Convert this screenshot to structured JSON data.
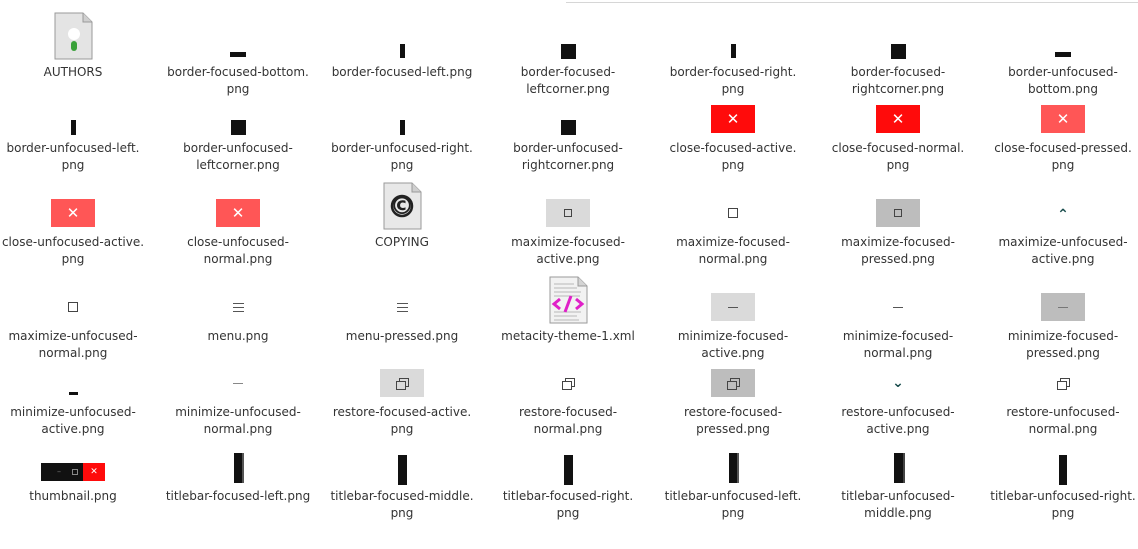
{
  "files": [
    {
      "name": "AUTHORS",
      "icon": "person-document-icon"
    },
    {
      "name": "border-focused-bottom.\npng",
      "icon": "black-bar-image-icon"
    },
    {
      "name": "border-focused-left.png",
      "icon": "black-bar-image-icon"
    },
    {
      "name": "border-focused-\nleftcorner.png",
      "icon": "black-square-image-icon"
    },
    {
      "name": "border-focused-right.\npng",
      "icon": "black-bar-image-icon"
    },
    {
      "name": "border-focused-\nrightcorner.png",
      "icon": "black-square-image-icon"
    },
    {
      "name": "border-unfocused-\nbottom.png",
      "icon": "black-bar-image-icon"
    },
    {
      "name": "border-unfocused-left.\npng",
      "icon": "black-bar-image-icon"
    },
    {
      "name": "border-unfocused-\nleftcorner.png",
      "icon": "black-square-image-icon"
    },
    {
      "name": "border-unfocused-right.\npng",
      "icon": "black-bar-image-icon"
    },
    {
      "name": "border-unfocused-\nrightcorner.png",
      "icon": "black-square-image-icon"
    },
    {
      "name": "close-focused-active.\npng",
      "icon": "close-icon"
    },
    {
      "name": "close-focused-normal.\npng",
      "icon": "close-icon"
    },
    {
      "name": "close-focused-pressed.\npng",
      "icon": "close-icon"
    },
    {
      "name": "close-unfocused-active.\npng",
      "icon": "close-icon"
    },
    {
      "name": "close-unfocused-\nnormal.png",
      "icon": "close-icon"
    },
    {
      "name": "COPYING",
      "icon": "copyright-document-icon"
    },
    {
      "name": "maximize-focused-\nactive.png",
      "icon": "maximize-icon"
    },
    {
      "name": "maximize-focused-\nnormal.png",
      "icon": "maximize-icon"
    },
    {
      "name": "maximize-focused-\npressed.png",
      "icon": "maximize-icon"
    },
    {
      "name": "maximize-unfocused-\nactive.png",
      "icon": "chevron-up-icon"
    },
    {
      "name": "maximize-unfocused-\nnormal.png",
      "icon": "maximize-icon"
    },
    {
      "name": "menu.png",
      "icon": "menu-icon"
    },
    {
      "name": "menu-pressed.png",
      "icon": "menu-icon"
    },
    {
      "name": "metacity-theme-1.xml",
      "icon": "xml-document-icon"
    },
    {
      "name": "minimize-focused-\nactive.png",
      "icon": "minimize-icon"
    },
    {
      "name": "minimize-focused-\nnormal.png",
      "icon": "minimize-icon"
    },
    {
      "name": "minimize-focused-\npressed.png",
      "icon": "minimize-icon"
    },
    {
      "name": "minimize-unfocused-\nactive.png",
      "icon": "minimize-icon"
    },
    {
      "name": "minimize-unfocused-\nnormal.png",
      "icon": "minimize-icon"
    },
    {
      "name": "restore-focused-active.\npng",
      "icon": "restore-icon"
    },
    {
      "name": "restore-focused-\nnormal.png",
      "icon": "restore-icon"
    },
    {
      "name": "restore-focused-\npressed.png",
      "icon": "restore-icon"
    },
    {
      "name": "restore-unfocused-\nactive.png",
      "icon": "chevron-down-icon"
    },
    {
      "name": "restore-unfocused-\nnormal.png",
      "icon": "restore-icon"
    },
    {
      "name": "thumbnail.png",
      "icon": "titlebar-thumbnail-icon"
    },
    {
      "name": "titlebar-focused-left.png",
      "icon": "black-bar-image-icon"
    },
    {
      "name": "titlebar-focused-middle.\npng",
      "icon": "black-bar-image-icon"
    },
    {
      "name": "titlebar-focused-right.\npng",
      "icon": "black-bar-image-icon"
    },
    {
      "name": "titlebar-unfocused-left.\npng",
      "icon": "black-bar-image-icon"
    },
    {
      "name": "titlebar-unfocused-\nmiddle.png",
      "icon": "black-bar-image-icon"
    },
    {
      "name": "titlebar-unfocused-right.\npng",
      "icon": "black-bar-image-icon"
    }
  ],
  "icons": {
    "close_glyph": "✕",
    "copyright_glyph": "©",
    "chevron_up_glyph": "⌃",
    "chevron_down_glyph": "⌄"
  },
  "colors": {
    "close_bright": "#ff0b0b",
    "close_soft": "#ff5656",
    "button_grey": "#dadada",
    "button_grey_pressed": "#bdbdbd"
  }
}
